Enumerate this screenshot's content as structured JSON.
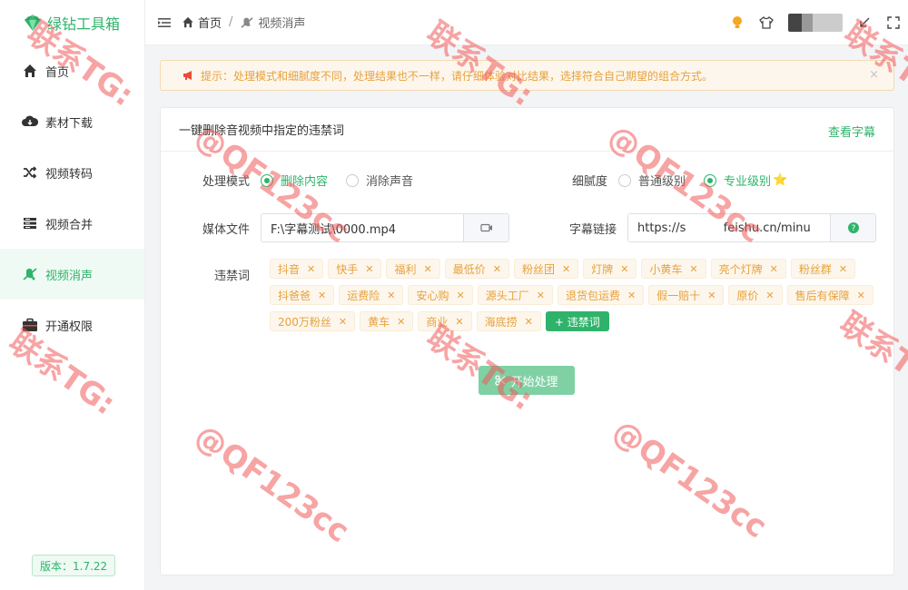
{
  "app": {
    "name": "绿钻工具箱",
    "version": "版本：1.7.22"
  },
  "sidebar": {
    "items": [
      {
        "label": "首页",
        "icon": "home-icon",
        "active": false
      },
      {
        "label": "素材下载",
        "icon": "cloud-download-icon",
        "active": false
      },
      {
        "label": "视频转码",
        "icon": "shuffle-icon",
        "active": false
      },
      {
        "label": "视频合并",
        "icon": "merge-icon",
        "active": false
      },
      {
        "label": "视频消声",
        "icon": "mute-icon",
        "active": true
      },
      {
        "label": "开通权限",
        "icon": "briefcase-icon",
        "active": false
      }
    ]
  },
  "header": {
    "breadcrumb": {
      "home": "首页",
      "current": "视频消声"
    },
    "icons": [
      "lightbulb-icon",
      "tshirt-icon",
      "avatar",
      "minimize-icon",
      "fullscreen-icon"
    ]
  },
  "alert": {
    "text": "提示：处理模式和细腻度不同，处理结果也不一样，请仔细体验对比结果，选择符合自己期望的组合方式。",
    "close": "×"
  },
  "panel": {
    "title": "一键删除音视频中指定的违禁词",
    "link": "查看字幕",
    "mode": {
      "label": "处理模式",
      "options": [
        "删除内容",
        "消除声音"
      ],
      "selected": "删除内容"
    },
    "fineness": {
      "label": "细腻度",
      "options": [
        "普通级别",
        "专业级别"
      ],
      "selected": "专业级别",
      "star": "⭐"
    },
    "media": {
      "label": "媒体文件",
      "value": "F:\\字幕测试\\0000.mp4"
    },
    "subtitle": {
      "label": "字幕链接",
      "value": "https://s          feishu.cn/minu"
    },
    "banned": {
      "label": "违禁词",
      "tags": [
        "抖音",
        "快手",
        "福利",
        "最低价",
        "粉丝团",
        "灯牌",
        "小黄车",
        "亮个灯牌",
        "粉丝群",
        "抖爸爸",
        "运费险",
        "安心购",
        "源头工厂",
        "退货包运费",
        "假一赔十",
        "原价",
        "售后有保障",
        "200万粉丝",
        "黄车",
        "商业",
        "海底捞"
      ],
      "add_label": "+ 违禁词"
    },
    "start_button": "开始处理"
  },
  "watermark": {
    "line1": "联系TG:",
    "line2": "@QF123cc"
  }
}
